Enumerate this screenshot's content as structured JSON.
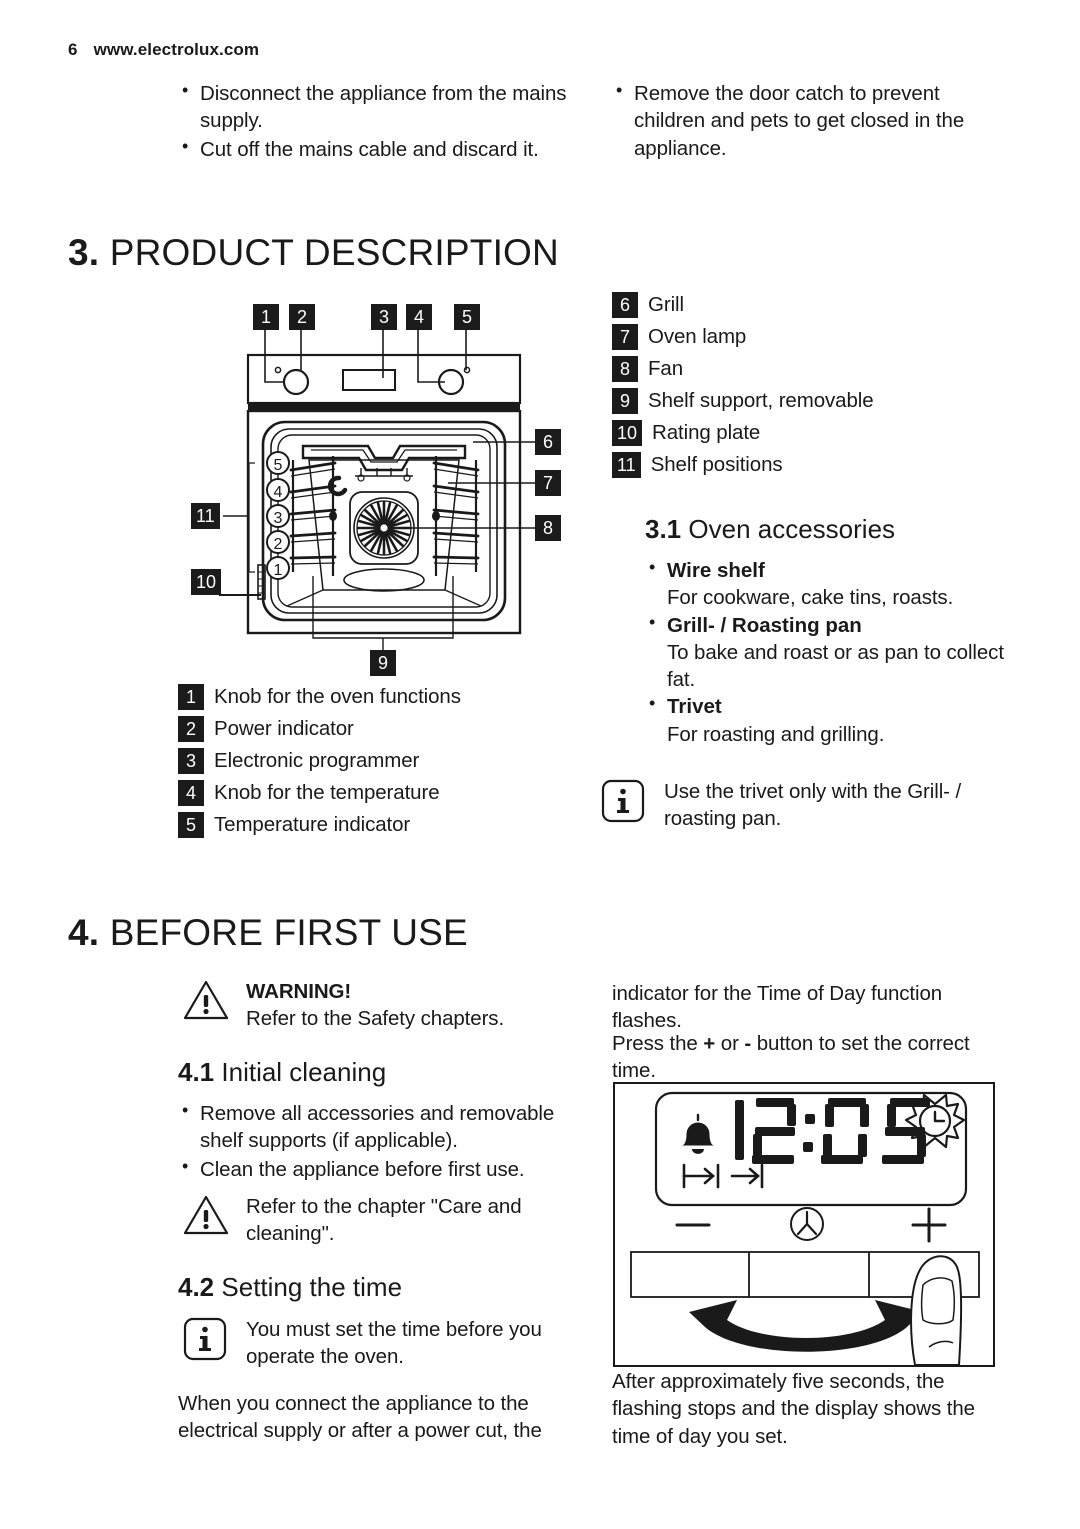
{
  "header": {
    "page_number": "6",
    "url": "www.electrolux.com"
  },
  "top_bullets_left": [
    "Disconnect the appliance from the mains supply.",
    "Cut off the mains cable and discard it."
  ],
  "top_bullets_right": [
    "Remove the door catch to prevent children and pets to get closed in the appliance."
  ],
  "chapter3": {
    "num": "3.",
    "title": "PRODUCT DESCRIPTION",
    "diagram": {
      "name": "oven-front-cutaway-diagram",
      "callouts_top": [
        "1",
        "2",
        "3",
        "4",
        "5"
      ],
      "callouts_right": [
        "6",
        "7",
        "8"
      ],
      "callout_bottom": "9",
      "callouts_left": [
        "11",
        "10"
      ],
      "shelf_positions": [
        "5",
        "4",
        "3",
        "2",
        "1"
      ]
    },
    "key_left": [
      {
        "num": "1",
        "label": "Knob for the oven functions"
      },
      {
        "num": "2",
        "label": "Power indicator"
      },
      {
        "num": "3",
        "label": "Electronic programmer"
      },
      {
        "num": "4",
        "label": "Knob for the temperature"
      },
      {
        "num": "5",
        "label": "Temperature indicator"
      }
    ],
    "key_right": [
      {
        "num": "6",
        "label": "Grill"
      },
      {
        "num": "7",
        "label": "Oven lamp"
      },
      {
        "num": "8",
        "label": "Fan"
      },
      {
        "num": "9",
        "label": "Shelf support, removable"
      },
      {
        "num": "10",
        "label": "Rating plate"
      },
      {
        "num": "11",
        "label": "Shelf positions"
      }
    ],
    "section31": {
      "num": "3.1",
      "title": "Oven accessories",
      "items": [
        {
          "name": "Wire shelf",
          "desc": "For cookware, cake tins, roasts."
        },
        {
          "name": "Grill- / Roasting pan",
          "desc": "To bake and roast or as pan to collect fat."
        },
        {
          "name": "Trivet",
          "desc": "For roasting and grilling."
        }
      ],
      "info_note": "Use the trivet only with the Grill- / roasting pan."
    }
  },
  "chapter4": {
    "num": "4.",
    "title": "BEFORE FIRST USE",
    "warning": {
      "title": "WARNING!",
      "body": "Refer to the Safety chapters."
    },
    "section41": {
      "num": "4.1",
      "title": "Initial cleaning",
      "bullets": [
        "Remove all accessories and removable shelf supports (if applicable).",
        "Clean the appliance before first use."
      ],
      "warning_note": "Refer to the chapter \"Care and cleaning\"."
    },
    "section42": {
      "num": "4.2",
      "title": "Setting the time",
      "info_note": "You must set the time before you operate the oven.",
      "para_left": "When you connect the appliance to the electrical supply or after a power cut, the",
      "para_right_1": "indicator for the Time of Day function flashes.",
      "para_right_2_a": "Press the ",
      "para_right_2_plus": "+",
      "para_right_2_b": " or ",
      "para_right_2_minus": "-",
      "para_right_2_c": " button to set the correct time.",
      "display": {
        "name": "oven-programmer-display-diagram",
        "time": "12:05",
        "bell_icon": "bell-icon",
        "sun_clock_icon": "duration-clock-icon",
        "end_time_icon": "end-time-icon",
        "duration_icon": "cook-duration-icon",
        "minus_label": "−",
        "clock_button_icon": "time-of-day-clock-icon",
        "plus_label": "+",
        "finger_icon": "finger-press-icon",
        "arrow_icon": "double-arrow-swipe-icon"
      },
      "para_after": "After approximately five seconds, the flashing stops and the display shows the time of day you set."
    }
  },
  "colors": {
    "ink": "#1a1a1a",
    "keybox_bg": "#1b1b1b",
    "keybox_fg": "#ffffff",
    "rule": "#000000"
  }
}
